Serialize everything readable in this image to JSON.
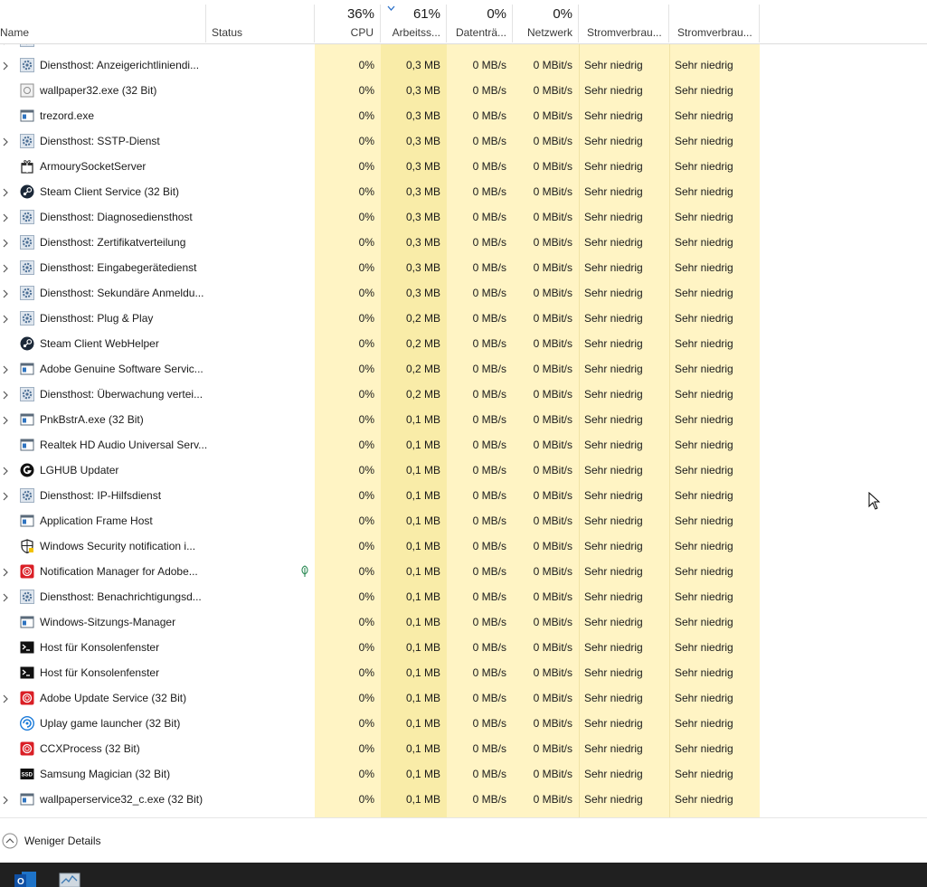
{
  "header": {
    "name_label": "Name",
    "status_label": "Status",
    "cpu_pct": "36%",
    "cpu_label": "CPU",
    "mem_pct": "61%",
    "mem_label": "Arbeitss...",
    "disk_pct": "0%",
    "disk_label": "Datenträ...",
    "net_pct": "0%",
    "net_label": "Netzwerk",
    "power_label": "Stromverbrau...",
    "power_trend_label": "Stromverbrau..."
  },
  "colors": {
    "cpu_col": "#fff4c4",
    "mem_col": "#f9eca8",
    "other_col": "#fff4c4",
    "accent": "#0063b1"
  },
  "processes": [
    {
      "name": "Diensthost: Anzeigerichtliniendi...",
      "icon": "gear-icon",
      "expandable": true,
      "cpu": "0%",
      "mem": "0,3 MB",
      "disk": "0 MB/s",
      "net": "0 MBit/s",
      "power": "Sehr niedrig",
      "power_trend": "Sehr niedrig"
    },
    {
      "name": "wallpaper32.exe (32 Bit)",
      "icon": "app-generic-icon",
      "expandable": false,
      "cpu": "0%",
      "mem": "0,3 MB",
      "disk": "0 MB/s",
      "net": "0 MBit/s",
      "power": "Sehr niedrig",
      "power_trend": "Sehr niedrig"
    },
    {
      "name": "trezord.exe",
      "icon": "window-icon",
      "expandable": false,
      "cpu": "0%",
      "mem": "0,3 MB",
      "disk": "0 MB/s",
      "net": "0 MBit/s",
      "power": "Sehr niedrig",
      "power_trend": "Sehr niedrig"
    },
    {
      "name": "Diensthost: SSTP-Dienst",
      "icon": "gear-icon",
      "expandable": true,
      "cpu": "0%",
      "mem": "0,3 MB",
      "disk": "0 MB/s",
      "net": "0 MBit/s",
      "power": "Sehr niedrig",
      "power_trend": "Sehr niedrig"
    },
    {
      "name": "ArmourySocketServer",
      "icon": "gift-icon",
      "expandable": false,
      "cpu": "0%",
      "mem": "0,3 MB",
      "disk": "0 MB/s",
      "net": "0 MBit/s",
      "power": "Sehr niedrig",
      "power_trend": "Sehr niedrig"
    },
    {
      "name": "Steam Client Service (32 Bit)",
      "icon": "steam-icon",
      "expandable": true,
      "cpu": "0%",
      "mem": "0,3 MB",
      "disk": "0 MB/s",
      "net": "0 MBit/s",
      "power": "Sehr niedrig",
      "power_trend": "Sehr niedrig"
    },
    {
      "name": "Diensthost: Diagnosediensthost",
      "icon": "gear-icon",
      "expandable": true,
      "cpu": "0%",
      "mem": "0,3 MB",
      "disk": "0 MB/s",
      "net": "0 MBit/s",
      "power": "Sehr niedrig",
      "power_trend": "Sehr niedrig"
    },
    {
      "name": "Diensthost: Zertifikatverteilung",
      "icon": "gear-icon",
      "expandable": true,
      "cpu": "0%",
      "mem": "0,3 MB",
      "disk": "0 MB/s",
      "net": "0 MBit/s",
      "power": "Sehr niedrig",
      "power_trend": "Sehr niedrig"
    },
    {
      "name": "Diensthost: Eingabegerätedienst",
      "icon": "gear-icon",
      "expandable": true,
      "cpu": "0%",
      "mem": "0,3 MB",
      "disk": "0 MB/s",
      "net": "0 MBit/s",
      "power": "Sehr niedrig",
      "power_trend": "Sehr niedrig"
    },
    {
      "name": "Diensthost: Sekundäre Anmeldu...",
      "icon": "gear-icon",
      "expandable": true,
      "cpu": "0%",
      "mem": "0,3 MB",
      "disk": "0 MB/s",
      "net": "0 MBit/s",
      "power": "Sehr niedrig",
      "power_trend": "Sehr niedrig"
    },
    {
      "name": "Diensthost: Plug & Play",
      "icon": "gear-icon",
      "expandable": true,
      "cpu": "0%",
      "mem": "0,2 MB",
      "disk": "0 MB/s",
      "net": "0 MBit/s",
      "power": "Sehr niedrig",
      "power_trend": "Sehr niedrig"
    },
    {
      "name": "Steam Client WebHelper",
      "icon": "steam-icon",
      "expandable": false,
      "cpu": "0%",
      "mem": "0,2 MB",
      "disk": "0 MB/s",
      "net": "0 MBit/s",
      "power": "Sehr niedrig",
      "power_trend": "Sehr niedrig"
    },
    {
      "name": "Adobe Genuine Software Servic...",
      "icon": "window-icon",
      "expandable": true,
      "cpu": "0%",
      "mem": "0,2 MB",
      "disk": "0 MB/s",
      "net": "0 MBit/s",
      "power": "Sehr niedrig",
      "power_trend": "Sehr niedrig"
    },
    {
      "name": "Diensthost: Überwachung vertei...",
      "icon": "gear-icon",
      "expandable": true,
      "cpu": "0%",
      "mem": "0,2 MB",
      "disk": "0 MB/s",
      "net": "0 MBit/s",
      "power": "Sehr niedrig",
      "power_trend": "Sehr niedrig"
    },
    {
      "name": "PnkBstrA.exe (32 Bit)",
      "icon": "window-icon",
      "expandable": true,
      "cpu": "0%",
      "mem": "0,1 MB",
      "disk": "0 MB/s",
      "net": "0 MBit/s",
      "power": "Sehr niedrig",
      "power_trend": "Sehr niedrig"
    },
    {
      "name": "Realtek HD Audio Universal Serv...",
      "icon": "window-icon",
      "expandable": false,
      "cpu": "0%",
      "mem": "0,1 MB",
      "disk": "0 MB/s",
      "net": "0 MBit/s",
      "power": "Sehr niedrig",
      "power_trend": "Sehr niedrig"
    },
    {
      "name": "LGHUB Updater",
      "icon": "logitech-icon",
      "expandable": true,
      "cpu": "0%",
      "mem": "0,1 MB",
      "disk": "0 MB/s",
      "net": "0 MBit/s",
      "power": "Sehr niedrig",
      "power_trend": "Sehr niedrig"
    },
    {
      "name": "Diensthost: IP-Hilfsdienst",
      "icon": "gear-icon",
      "expandable": true,
      "cpu": "0%",
      "mem": "0,1 MB",
      "disk": "0 MB/s",
      "net": "0 MBit/s",
      "power": "Sehr niedrig",
      "power_trend": "Sehr niedrig"
    },
    {
      "name": "Application Frame Host",
      "icon": "window-icon",
      "expandable": false,
      "cpu": "0%",
      "mem": "0,1 MB",
      "disk": "0 MB/s",
      "net": "0 MBit/s",
      "power": "Sehr niedrig",
      "power_trend": "Sehr niedrig"
    },
    {
      "name": "Windows Security notification i...",
      "icon": "shield-icon",
      "expandable": false,
      "cpu": "0%",
      "mem": "0,1 MB",
      "disk": "0 MB/s",
      "net": "0 MBit/s",
      "power": "Sehr niedrig",
      "power_trend": "Sehr niedrig"
    },
    {
      "name": "Notification Manager for Adobe...",
      "icon": "adobe-icon",
      "expandable": true,
      "suspended": true,
      "cpu": "0%",
      "mem": "0,1 MB",
      "disk": "0 MB/s",
      "net": "0 MBit/s",
      "power": "Sehr niedrig",
      "power_trend": "Sehr niedrig"
    },
    {
      "name": "Diensthost: Benachrichtigungsd...",
      "icon": "gear-icon",
      "expandable": true,
      "cpu": "0%",
      "mem": "0,1 MB",
      "disk": "0 MB/s",
      "net": "0 MBit/s",
      "power": "Sehr niedrig",
      "power_trend": "Sehr niedrig"
    },
    {
      "name": "Windows-Sitzungs-Manager",
      "icon": "window-icon",
      "expandable": false,
      "cpu": "0%",
      "mem": "0,1 MB",
      "disk": "0 MB/s",
      "net": "0 MBit/s",
      "power": "Sehr niedrig",
      "power_trend": "Sehr niedrig"
    },
    {
      "name": "Host für Konsolenfenster",
      "icon": "console-icon",
      "expandable": false,
      "cpu": "0%",
      "mem": "0,1 MB",
      "disk": "0 MB/s",
      "net": "0 MBit/s",
      "power": "Sehr niedrig",
      "power_trend": "Sehr niedrig"
    },
    {
      "name": "Host für Konsolenfenster",
      "icon": "console-icon",
      "expandable": false,
      "cpu": "0%",
      "mem": "0,1 MB",
      "disk": "0 MB/s",
      "net": "0 MBit/s",
      "power": "Sehr niedrig",
      "power_trend": "Sehr niedrig"
    },
    {
      "name": "Adobe Update Service (32 Bit)",
      "icon": "adobe-icon",
      "expandable": true,
      "cpu": "0%",
      "mem": "0,1 MB",
      "disk": "0 MB/s",
      "net": "0 MBit/s",
      "power": "Sehr niedrig",
      "power_trend": "Sehr niedrig"
    },
    {
      "name": "Uplay game launcher (32 Bit)",
      "icon": "uplay-icon",
      "expandable": false,
      "cpu": "0%",
      "mem": "0,1 MB",
      "disk": "0 MB/s",
      "net": "0 MBit/s",
      "power": "Sehr niedrig",
      "power_trend": "Sehr niedrig"
    },
    {
      "name": "CCXProcess (32 Bit)",
      "icon": "adobe-icon",
      "expandable": false,
      "cpu": "0%",
      "mem": "0,1 MB",
      "disk": "0 MB/s",
      "net": "0 MBit/s",
      "power": "Sehr niedrig",
      "power_trend": "Sehr niedrig"
    },
    {
      "name": "Samsung Magician (32 Bit)",
      "icon": "ssd-icon",
      "expandable": false,
      "cpu": "0%",
      "mem": "0,1 MB",
      "disk": "0 MB/s",
      "net": "0 MBit/s",
      "power": "Sehr niedrig",
      "power_trend": "Sehr niedrig"
    },
    {
      "name": "wallpaperservice32_c.exe (32 Bit)",
      "icon": "window-icon",
      "expandable": true,
      "cpu": "0%",
      "mem": "0,1 MB",
      "disk": "0 MB/s",
      "net": "0 MBit/s",
      "power": "Sehr niedrig",
      "power_trend": "Sehr niedrig"
    }
  ],
  "footer": {
    "less_details_label": "Weniger Details"
  },
  "taskbar": {
    "items": [
      "outlook-icon",
      "task-manager-icon"
    ]
  }
}
